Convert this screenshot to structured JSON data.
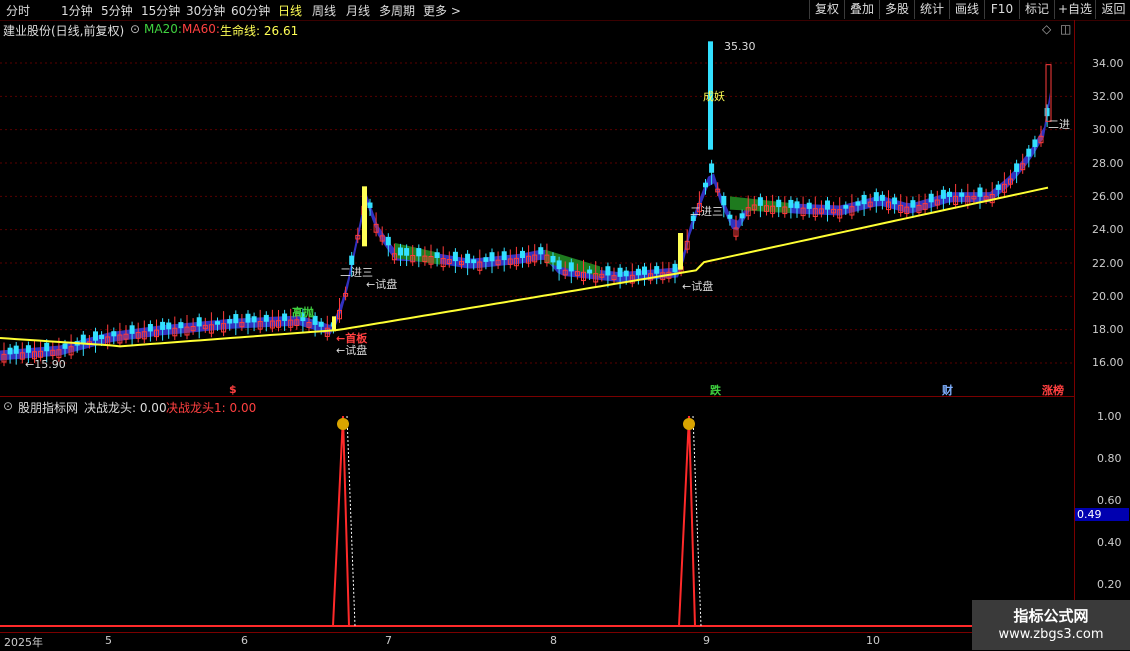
{
  "periods": [
    "分时",
    "1分钟",
    "5分钟",
    "15分钟",
    "30分钟",
    "60分钟",
    "日线",
    "周线",
    "月线",
    "多周期",
    "更多 >"
  ],
  "toolbar": [
    "复权",
    "叠加",
    "多股",
    "统计",
    "画线",
    "F10",
    "标记",
    "+自选",
    "返回"
  ],
  "info": {
    "title": "建业股份(日线,前复权)",
    "ma20": "MA20:",
    "ma60": "MA60:",
    "life": "生命线: 26.61"
  },
  "price_axis": [
    "34.00",
    "32.00",
    "30.00",
    "28.00",
    "26.00",
    "24.00",
    "22.00",
    "20.00",
    "18.00",
    "16.00"
  ],
  "ind_axis": [
    "1.00",
    "0.80",
    "0.60",
    "0.40",
    "0.20"
  ],
  "ind_current": "0.49",
  "indicator": {
    "site": "股朋指标网",
    "jz": "决战龙头: 0.00",
    "jz1": "决战龙头1: 0.00"
  },
  "dates": [
    "2025年",
    "5",
    "6",
    "7",
    "8",
    "9",
    "10"
  ],
  "annotations": {
    "low": "←15.90",
    "high": "35.30",
    "gaopao": "高抛",
    "shouban": "←首板",
    "shipan1": "←试盘",
    "shipan2": "←试盘",
    "shipan3": "←试盘",
    "erjinsan1": "二进三",
    "erjinsan2": "二进三",
    "erjin": "二进",
    "chengyao": "成妖"
  },
  "bottom_signals": {
    "s1": "$",
    "die": "跌",
    "cai": "财",
    "zhangbang": "涨榜"
  },
  "watermark": {
    "line1": "指标公式网",
    "line2": "www.zbgs3.com"
  },
  "chart_data": {
    "type": "line",
    "price_ylim": [
      15.9,
      35.3
    ],
    "low": 15.9,
    "high": 35.3,
    "life_line_last": 26.61,
    "indicator_series": [
      {
        "name": "决战龙头",
        "peaks_at": [
          "2025-06 end",
          "2025-08 end"
        ],
        "peak_value": 1.0
      }
    ],
    "indicator_ylim": [
      0,
      1.0
    ]
  }
}
